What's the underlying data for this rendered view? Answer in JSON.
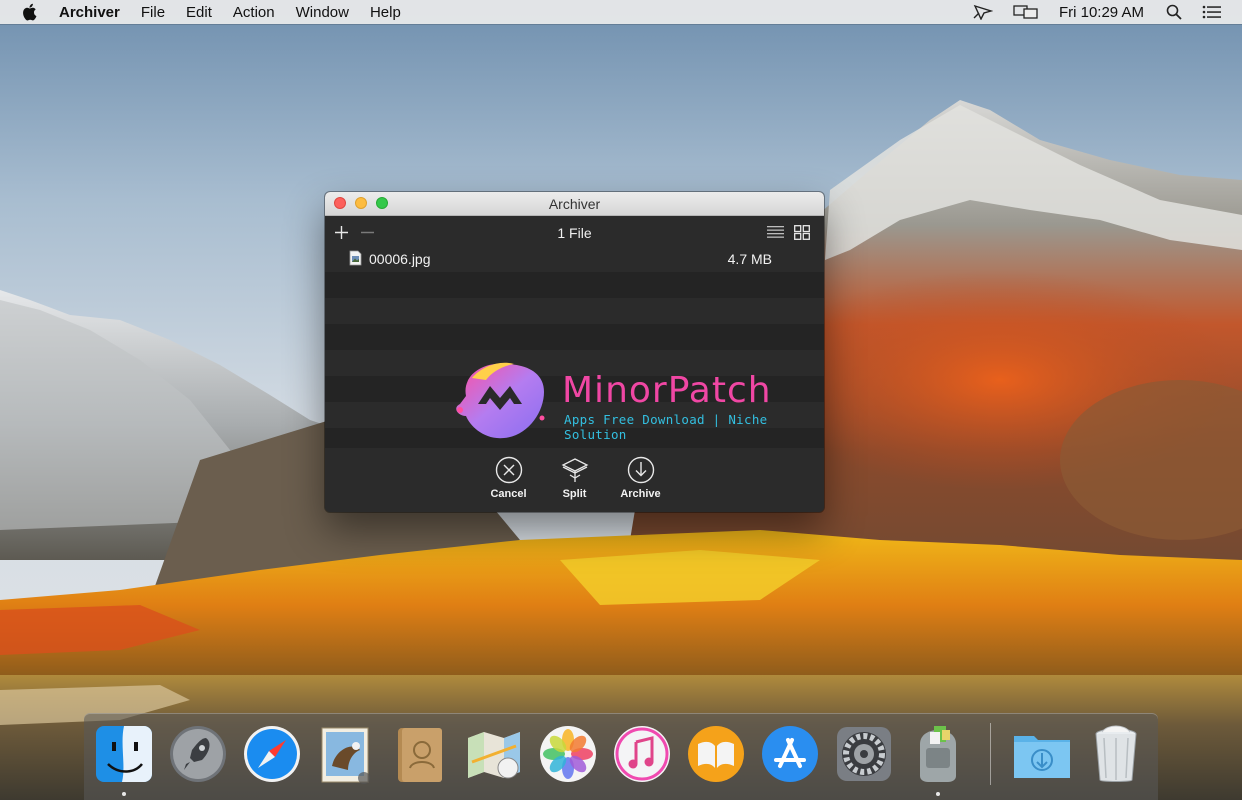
{
  "menubar": {
    "app_name": "Archiver",
    "menus": [
      "File",
      "Edit",
      "Action",
      "Window",
      "Help"
    ],
    "clock": "Fri 10:29 AM"
  },
  "window": {
    "title": "Archiver",
    "file_count": "1 File",
    "files": [
      {
        "name": "00006.jpg",
        "size": "4.7 MB"
      }
    ],
    "actions": {
      "cancel": "Cancel",
      "split": "Split",
      "archive": "Archive"
    }
  },
  "watermark": {
    "title": "MinorPatch",
    "subtitle": "Apps Free Download | Niche Solution"
  },
  "dock": {
    "items": [
      {
        "name": "finder-icon",
        "running": true
      },
      {
        "name": "launchpad-icon",
        "running": false
      },
      {
        "name": "safari-icon",
        "running": false
      },
      {
        "name": "mail-icon",
        "running": false
      },
      {
        "name": "contacts-icon",
        "running": false
      },
      {
        "name": "maps-icon",
        "running": false
      },
      {
        "name": "photos-icon",
        "running": false
      },
      {
        "name": "itunes-icon",
        "running": false
      },
      {
        "name": "ibooks-icon",
        "running": false
      },
      {
        "name": "app-store-icon",
        "running": false
      },
      {
        "name": "system-preferences-icon",
        "running": false
      },
      {
        "name": "archiver-icon",
        "running": true
      },
      {
        "name": "downloads-folder-icon",
        "running": false
      },
      {
        "name": "trash-icon",
        "running": false
      }
    ]
  },
  "colors": {
    "window_bg": "#2b2b2b",
    "row_alt": "#242424",
    "watermark_pink": "#f047a4",
    "watermark_cyan": "#33bfe0"
  }
}
